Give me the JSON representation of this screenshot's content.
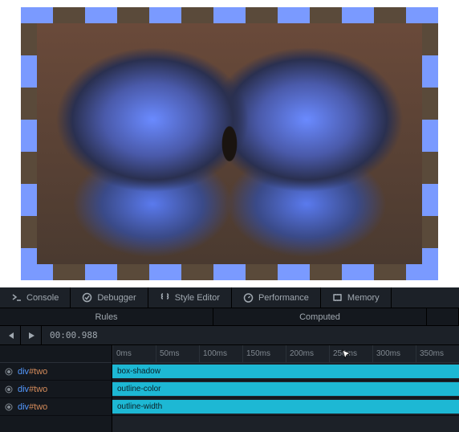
{
  "preview": {
    "element": "div#two"
  },
  "tabs": [
    {
      "label": "Console",
      "icon": "console-icon"
    },
    {
      "label": "Debugger",
      "icon": "debugger-icon"
    },
    {
      "label": "Style Editor",
      "icon": "style-editor-icon"
    },
    {
      "label": "Performance",
      "icon": "performance-icon"
    },
    {
      "label": "Memory",
      "icon": "memory-icon"
    }
  ],
  "subtabs": {
    "rules": "Rules",
    "computed": "Computed"
  },
  "controls": {
    "time": "00:00.988"
  },
  "ruler": [
    "0ms",
    "50ms",
    "100ms",
    "150ms",
    "200ms",
    "250ms",
    "300ms",
    "350ms"
  ],
  "tracks": [
    {
      "selector_tag": "div",
      "selector_id": "#two",
      "property": "box-shadow"
    },
    {
      "selector_tag": "div",
      "selector_id": "#two",
      "property": "outline-color"
    },
    {
      "selector_tag": "div",
      "selector_id": "#two",
      "property": "outline-width"
    }
  ]
}
